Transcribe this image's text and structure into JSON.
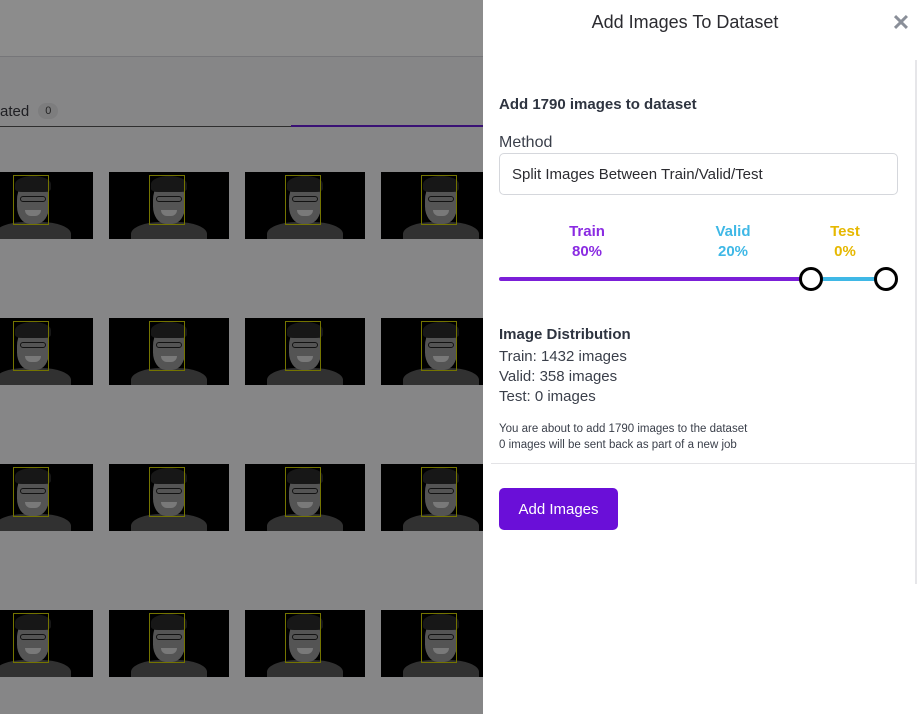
{
  "background": {
    "tab_label": "ated",
    "tab_count": "0",
    "thumbnail_rows": 4,
    "thumbnail_cols": 4
  },
  "drawer": {
    "title": "Add Images To Dataset",
    "close_icon": "close-icon",
    "heading": "Add 1790 images to dataset",
    "method_label": "Method",
    "method_value": "Split Images Between Train/Valid/Test",
    "split": {
      "train_label": "Train",
      "train_pct": "80%",
      "valid_label": "Valid",
      "valid_pct": "20%",
      "test_label": "Test",
      "test_pct": "0%"
    },
    "distribution": {
      "heading": "Image Distribution",
      "train": "Train: 1432 images",
      "valid": "Valid: 358 images",
      "test": "Test: 0 images"
    },
    "note_1": "You are about to add 1790 images to the dataset",
    "note_2": "0 images will be sent back as part of a new job",
    "add_button": "Add Images"
  },
  "colors": {
    "train": "#8a2be2",
    "valid": "#3fb8e6",
    "test": "#e6b800",
    "primary_button": "#6a0fd8"
  }
}
